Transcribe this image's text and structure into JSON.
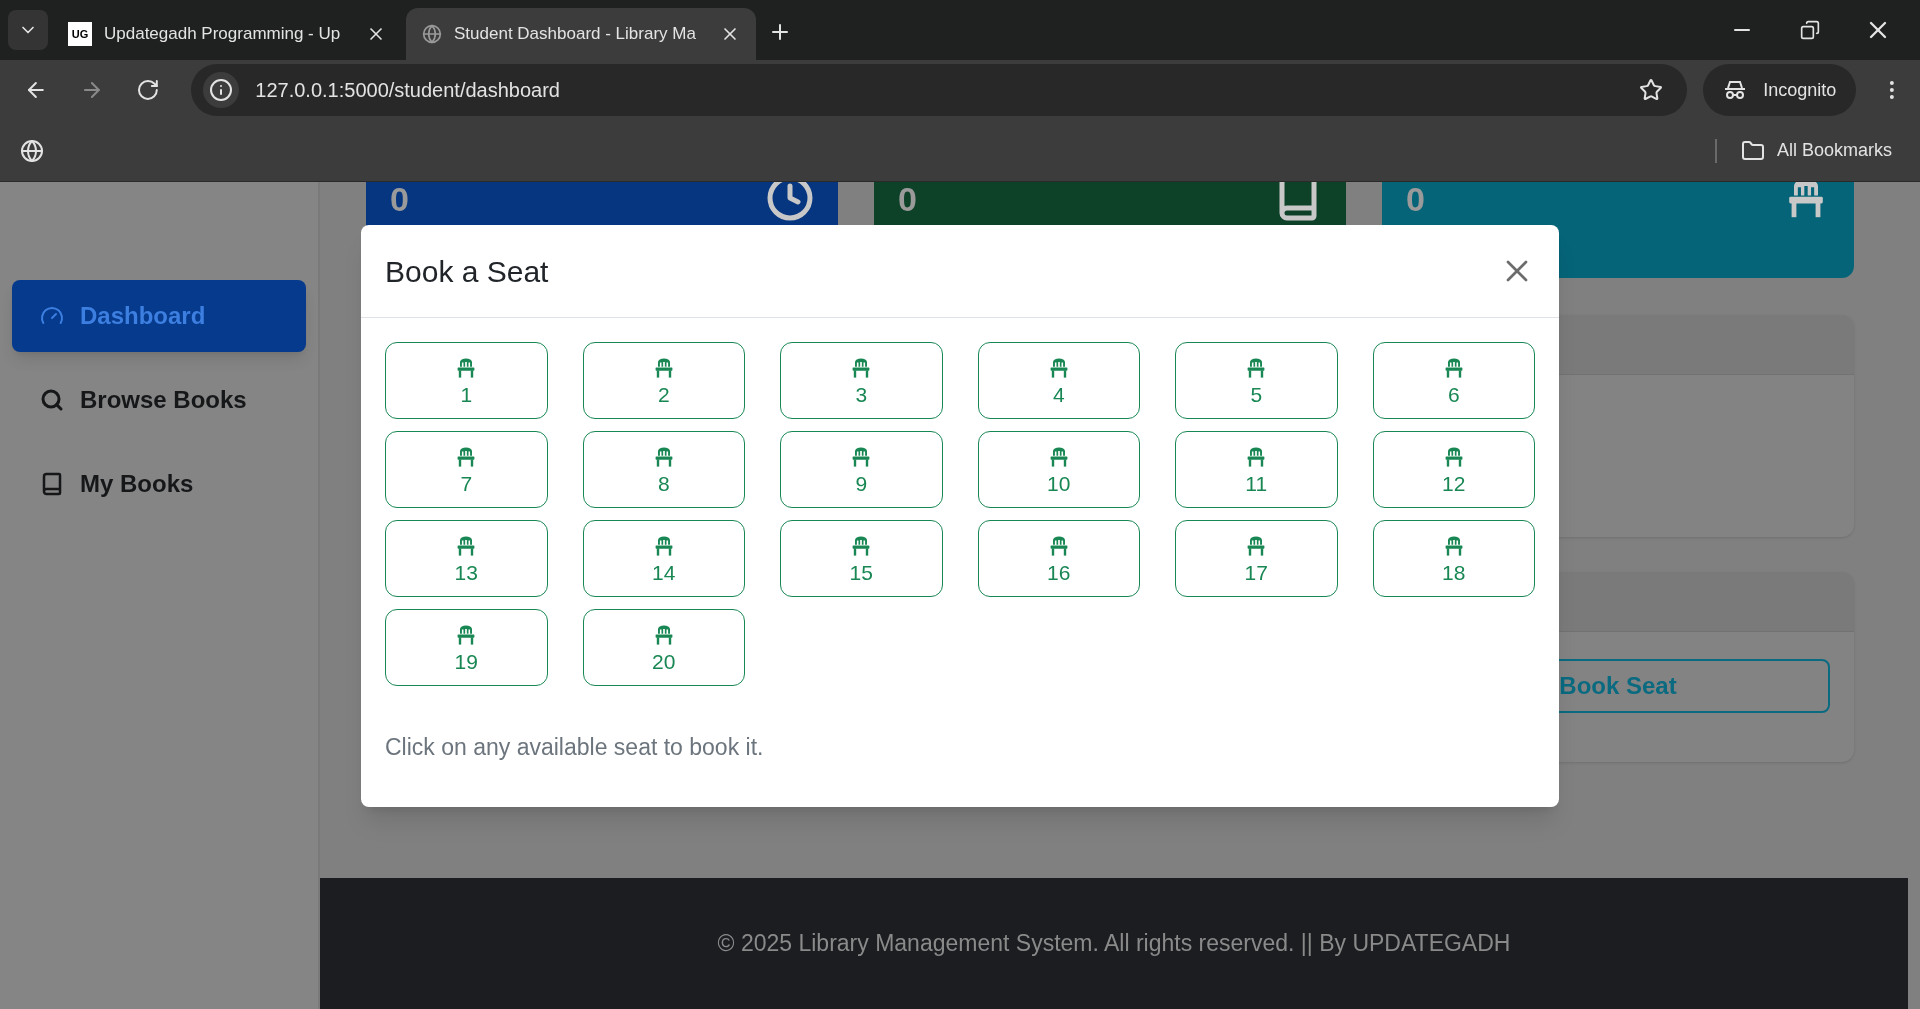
{
  "browser": {
    "tabs": [
      {
        "title": "Updategadh Programming - Up",
        "kind": "logo",
        "logo_text": "UG",
        "selected": false
      },
      {
        "title": "Student Dashboard - Library Ma",
        "kind": "globe",
        "selected": true
      }
    ],
    "address": "127.0.0.1:5000/student/dashboard",
    "profile": "Incognito",
    "bookmarks": "All Bookmarks"
  },
  "sidebar": {
    "items": [
      {
        "label": "Dashboard",
        "kind": "gauge",
        "selected": true
      },
      {
        "label": "Browse Books",
        "kind": "search",
        "selected": false
      },
      {
        "label": "My Books",
        "kind": "book",
        "selected": false
      }
    ]
  },
  "stat_cards": [
    {
      "value": "0",
      "kind": "clock",
      "color": "#06367f"
    },
    {
      "value": "0",
      "kind": "book",
      "color": "#0d4229"
    },
    {
      "value": "0",
      "kind": "chair",
      "color": "#066478"
    }
  ],
  "book_seat_button": "Book Seat",
  "modal": {
    "title": "Book a Seat",
    "seats": [
      "1",
      "2",
      "3",
      "4",
      "5",
      "6",
      "7",
      "8",
      "9",
      "10",
      "11",
      "12",
      "13",
      "14",
      "15",
      "16",
      "17",
      "18",
      "19",
      "20"
    ],
    "note": "Click on any available seat to book it."
  },
  "footer": "© 2025 Library Management System. All rights reserved. || By UPDATEGADH"
}
